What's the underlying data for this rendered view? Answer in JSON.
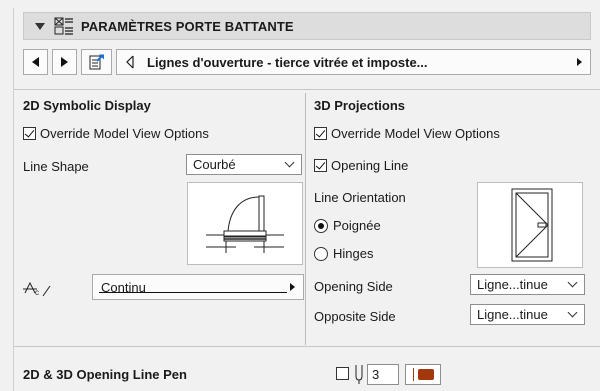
{
  "header": {
    "title": "PARAMÈTRES PORTE BATTANTE",
    "icon": "door-settings-icon"
  },
  "nav": {
    "prev_icon": "triangle-left-icon",
    "next_icon": "triangle-right-icon",
    "preset_icon": "export-preset-icon",
    "preset_label": "Lignes d'ouverture - tierce vitrée et imposte..."
  },
  "left": {
    "title": "2D Symbolic Display",
    "override_label": "Override Model View Options",
    "override_checked": true,
    "line_shape_label": "Line Shape",
    "line_shape_value": "Courbé",
    "line_type_value": "Continu"
  },
  "right": {
    "title": "3D Projections",
    "override_label": "Override Model View Options",
    "override_checked": true,
    "opening_line_label": "Opening Line",
    "opening_line_checked": true,
    "orientation_label": "Line Orientation",
    "orientation_options": [
      "Poignée",
      "Hinges"
    ],
    "orientation_selected": "Poignée",
    "opening_side_label": "Opening Side",
    "opening_side_value": "Ligne...tinue",
    "opposite_side_label": "Opposite Side",
    "opposite_side_value": "Ligne...tinue"
  },
  "footer": {
    "pen_label": "2D & 3D Opening Line Pen",
    "pen_number": "3",
    "pen_color": "#a2380c"
  }
}
